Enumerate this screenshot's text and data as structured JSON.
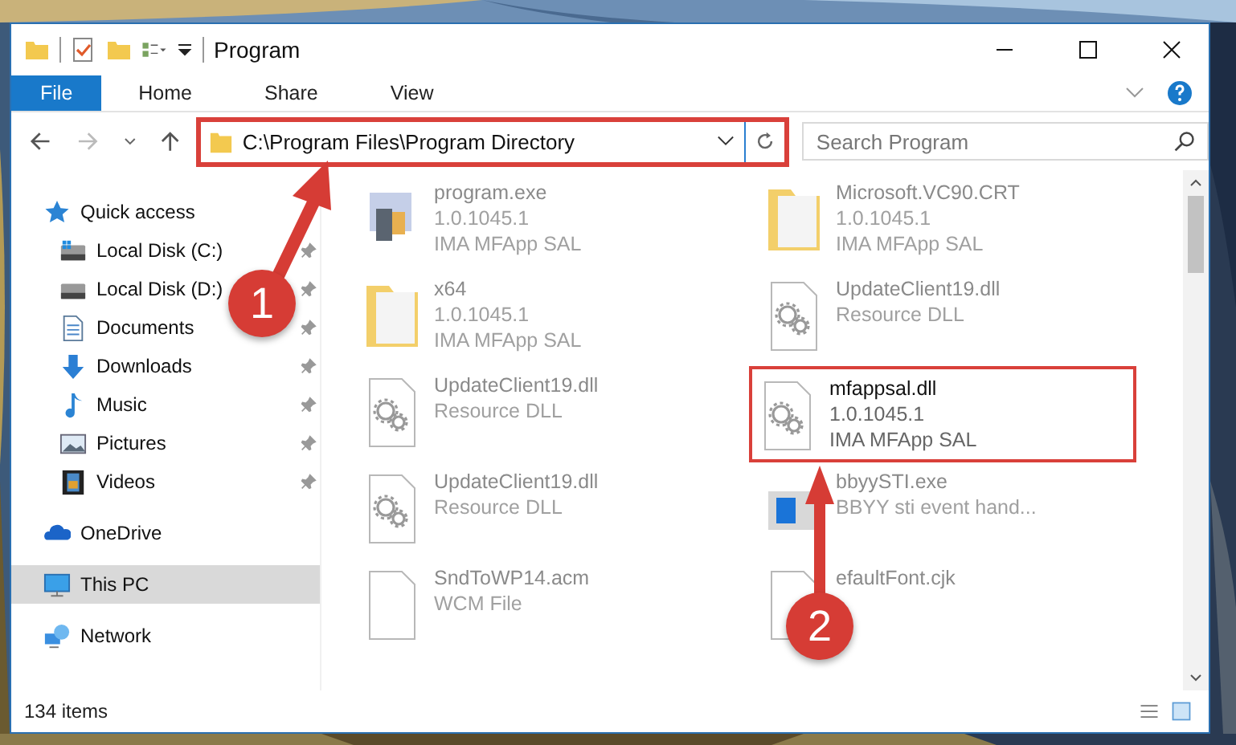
{
  "window": {
    "title": "Program"
  },
  "ribbon": {
    "tabs": [
      {
        "label": "File",
        "selected": true
      },
      {
        "label": "Home",
        "selected": false
      },
      {
        "label": "Share",
        "selected": false
      },
      {
        "label": "View",
        "selected": false
      }
    ]
  },
  "address": {
    "path": "C:\\Program Files\\Program Directory"
  },
  "search": {
    "placeholder": "Search Program"
  },
  "sidebar": {
    "items": [
      {
        "label": "Quick access",
        "kind": "star",
        "selected": false,
        "children": [
          {
            "label": "Local Disk (C:)",
            "kind": "disk-c",
            "pinned": true,
            "selected": false
          },
          {
            "label": "Local Disk (D:)",
            "kind": "disk",
            "pinned": true,
            "selected": false
          },
          {
            "label": "Documents",
            "kind": "documents",
            "pinned": true,
            "selected": false
          },
          {
            "label": "Downloads",
            "kind": "downloads",
            "pinned": true,
            "selected": false
          },
          {
            "label": "Music",
            "kind": "music",
            "pinned": true,
            "selected": false
          },
          {
            "label": "Pictures",
            "kind": "pictures",
            "pinned": true,
            "selected": false
          },
          {
            "label": "Videos",
            "kind": "videos",
            "pinned": true,
            "selected": false
          }
        ]
      },
      {
        "label": "OneDrive",
        "kind": "cloud",
        "selected": false
      },
      {
        "label": "This PC",
        "kind": "pc",
        "selected": true
      },
      {
        "label": "Network",
        "kind": "network",
        "selected": false
      }
    ]
  },
  "files": [
    {
      "name": "program.exe",
      "details": [
        "1.0.1045.1",
        "IMA MFApp SAL"
      ],
      "kind": "exe",
      "highlighted": false
    },
    {
      "name": "Microsoft.VC90.CRT",
      "details": [
        "1.0.1045.1",
        "IMA MFApp SAL"
      ],
      "kind": "folder",
      "highlighted": false
    },
    {
      "name": "x64",
      "details": [
        "1.0.1045.1",
        "IMA MFApp SAL"
      ],
      "kind": "folder",
      "highlighted": false
    },
    {
      "name": "UpdateClient19.dll",
      "details": [
        "Resource DLL"
      ],
      "kind": "dll",
      "highlighted": false
    },
    {
      "name": "UpdateClient19.dll",
      "details": [
        "Resource DLL"
      ],
      "kind": "dll",
      "highlighted": false
    },
    {
      "name": "mfappsal.dll",
      "details": [
        "1.0.1045.1",
        "IMA MFApp SAL"
      ],
      "kind": "dll",
      "highlighted": true
    },
    {
      "name": "UpdateClient19.dll",
      "details": [
        "Resource DLL"
      ],
      "kind": "dll",
      "highlighted": false
    },
    {
      "name": "bbyySTI.exe",
      "details": [
        "BBYY sti event hand..."
      ],
      "kind": "app",
      "highlighted": false
    },
    {
      "name": "SndToWP14.acm",
      "details": [
        "WCM File"
      ],
      "kind": "file",
      "highlighted": false
    },
    {
      "name": "efaultFont.cjk",
      "kind": "file",
      "highlighted": false
    }
  ],
  "status_bar": {
    "count": "134 items"
  },
  "annotations": [
    {
      "label": "1"
    },
    {
      "label": "2"
    }
  ]
}
